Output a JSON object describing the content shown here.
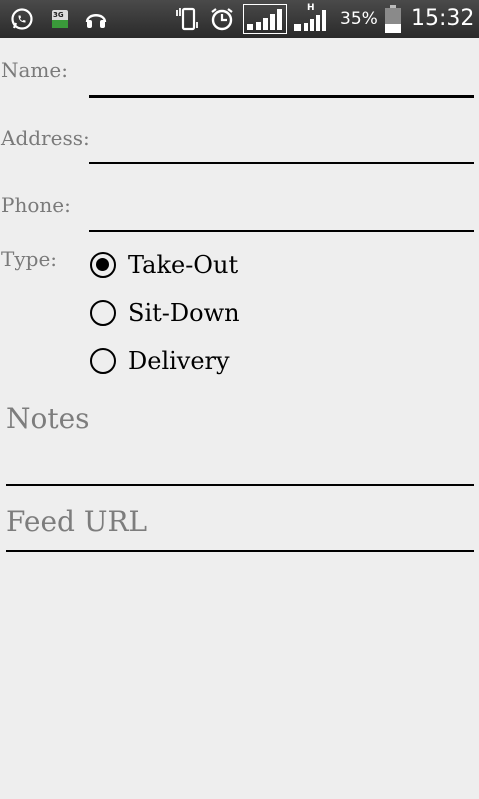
{
  "status_bar": {
    "icons": [
      "whatsapp-icon",
      "sim-3g-icon",
      "headphones-icon",
      "vibrate-icon",
      "alarm-icon",
      "signal-icon",
      "signal-h-icon",
      "battery-icon"
    ],
    "network_badge": "3G",
    "data_badge": "H",
    "battery_percent": "35%",
    "time": "15:32"
  },
  "form": {
    "name_label": "Name:",
    "name_value": "",
    "address_label": "Address:",
    "address_value": "",
    "phone_label": "Phone:",
    "phone_value": "",
    "type_label": "Type:",
    "type_options": [
      "Take-Out",
      "Sit-Down",
      "Delivery"
    ],
    "type_selected": "Take-Out",
    "notes_placeholder": "Notes",
    "feed_url_placeholder": "Feed URL"
  }
}
